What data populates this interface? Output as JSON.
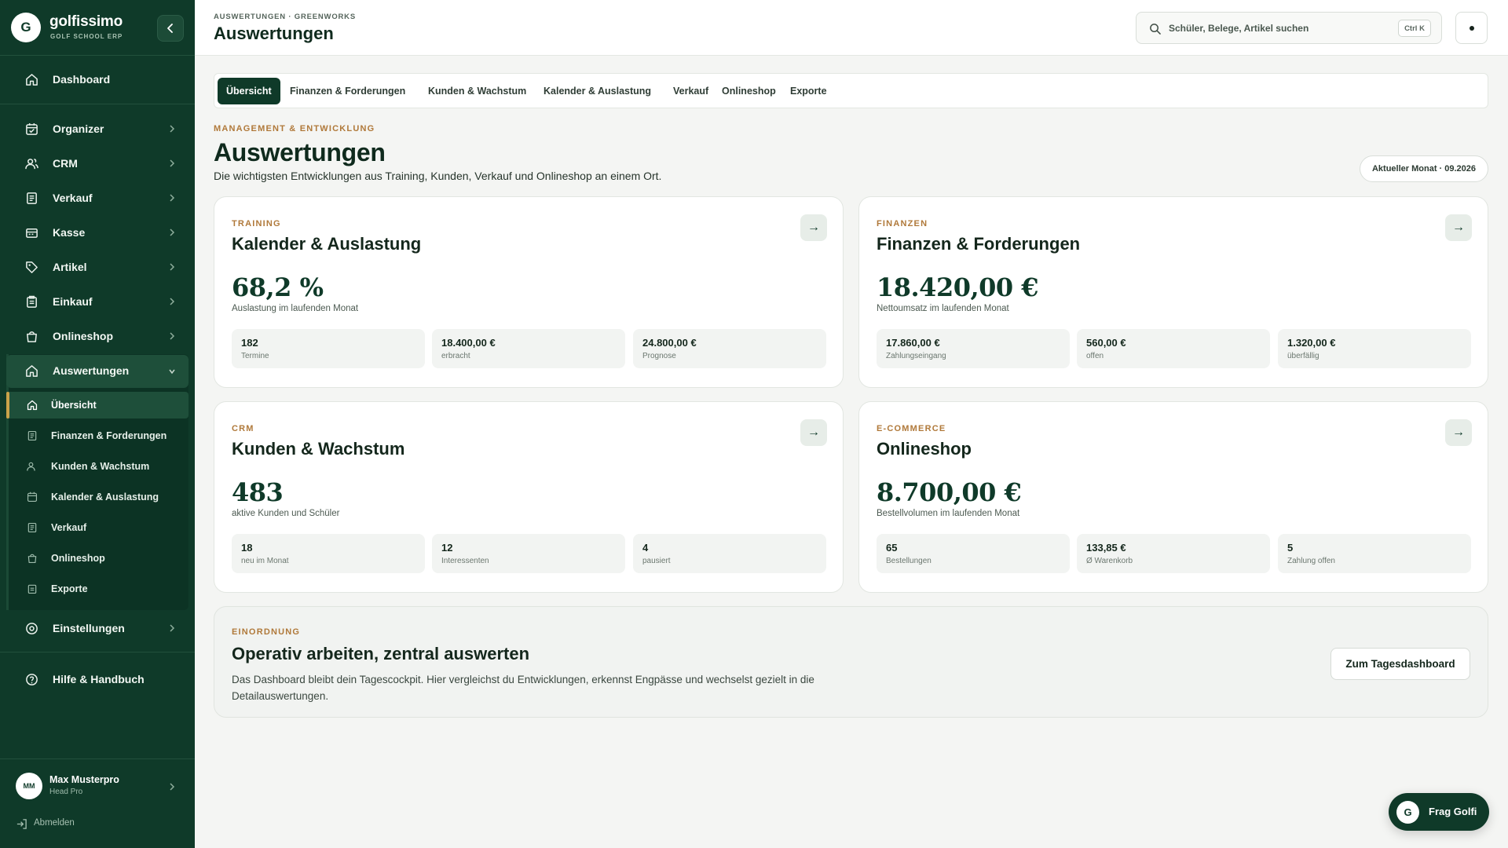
{
  "brand": {
    "logo_letter": "G",
    "name": "golfissimo",
    "subtitle": "GOLF SCHOOL ERP"
  },
  "sidebar": {
    "dashboard": "Dashboard",
    "items": [
      {
        "label": "Organizer",
        "icon": "calendar-icon"
      },
      {
        "label": "CRM",
        "icon": "users-icon"
      },
      {
        "label": "Verkauf",
        "icon": "receipt-icon"
      },
      {
        "label": "Kasse",
        "icon": "cash-register-icon"
      },
      {
        "label": "Artikel",
        "icon": "tag-icon"
      },
      {
        "label": "Einkauf",
        "icon": "clipboard-icon"
      },
      {
        "label": "Onlineshop",
        "icon": "shopping-bag-icon"
      },
      {
        "label": "Auswertungen",
        "icon": "home-icon"
      }
    ],
    "sub_items": [
      {
        "label": "Übersicht",
        "icon": "home-icon"
      },
      {
        "label": "Finanzen & Forderungen",
        "icon": "receipt-icon"
      },
      {
        "label": "Kunden & Wachstum",
        "icon": "users-icon"
      },
      {
        "label": "Kalender & Auslastung",
        "icon": "calendar-icon"
      },
      {
        "label": "Verkauf",
        "icon": "receipt-icon"
      },
      {
        "label": "Onlineshop",
        "icon": "shopping-bag-icon"
      },
      {
        "label": "Exporte",
        "icon": "clipboard-icon"
      }
    ],
    "settings": "Einstellungen",
    "help": "Hilfe & Handbuch",
    "user": {
      "initials": "MM",
      "name": "Max Musterpro",
      "role": "Head Pro"
    },
    "logout": "Abmelden"
  },
  "header": {
    "breadcrumb": "AUSWERTUNGEN · GREENWORKS",
    "title": "Auswertungen",
    "search_placeholder": "Schüler, Belege, Artikel suchen",
    "search_shortcut": "Ctrl K"
  },
  "tabs": [
    "Übersicht",
    "Finanzen & Forderungen",
    "Kunden & Wachstum",
    "Kalender & Auslastung",
    "Verkauf",
    "Onlineshop",
    "Exporte"
  ],
  "page": {
    "eyebrow": "MANAGEMENT & ENTWICKLUNG",
    "title": "Auswertungen",
    "subtitle": "Die wichtigsten Entwicklungen aus Training, Kunden, Verkauf und Onlineshop an einem Ort.",
    "month_pill": "Aktueller Monat · 09.2026"
  },
  "cards": [
    {
      "eyebrow": "TRAINING",
      "title": "Kalender & Auslastung",
      "big": "68,2 %",
      "big_sub": "Auslastung im laufenden Monat",
      "stats": [
        {
          "value": "182",
          "label": "Termine"
        },
        {
          "value": "18.400,00 €",
          "label": "erbracht"
        },
        {
          "value": "24.800,00 €",
          "label": "Prognose"
        }
      ]
    },
    {
      "eyebrow": "FINANZEN",
      "title": "Finanzen & Forderungen",
      "big": "18.420,00 €",
      "big_sub": "Nettoumsatz im laufenden Monat",
      "stats": [
        {
          "value": "17.860,00 €",
          "label": "Zahlungseingang"
        },
        {
          "value": "560,00 €",
          "label": "offen"
        },
        {
          "value": "1.320,00 €",
          "label": "überfällig"
        }
      ]
    },
    {
      "eyebrow": "CRM",
      "title": "Kunden & Wachstum",
      "big": "483",
      "big_sub": "aktive Kunden und Schüler",
      "stats": [
        {
          "value": "18",
          "label": "neu im Monat"
        },
        {
          "value": "12",
          "label": "Interessenten"
        },
        {
          "value": "4",
          "label": "pausiert"
        }
      ]
    },
    {
      "eyebrow": "E-COMMERCE",
      "title": "Onlineshop",
      "big": "8.700,00 €",
      "big_sub": "Bestellvolumen im laufenden Monat",
      "stats": [
        {
          "value": "65",
          "label": "Bestellungen"
        },
        {
          "value": "133,85 €",
          "label": "Ø Warenkorb"
        },
        {
          "value": "5",
          "label": "Zahlung offen"
        }
      ]
    }
  ],
  "panel": {
    "eyebrow": "EINORDNUNG",
    "title": "Operativ arbeiten, zentral auswerten",
    "text": "Das Dashboard bleibt dein Tagescockpit. Hier vergleichst du Entwicklungen, erkennst Engpässe und wechselst gezielt in die Detailauswertungen.",
    "button": "Zum Tagesdashboard"
  },
  "assistant": {
    "logo_letter": "G",
    "label": "Frag Golfi"
  },
  "colors": {
    "sidebar": "#0f3a29",
    "accent": "#b0793a",
    "active_marker": "#c9a24a"
  }
}
